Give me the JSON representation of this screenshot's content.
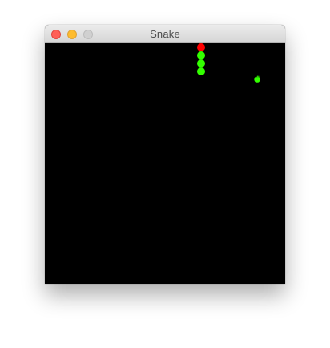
{
  "window": {
    "title": "Snake",
    "buttons": {
      "close": {
        "icon": "close-icon",
        "color": "#ff5f57"
      },
      "minimize": {
        "icon": "minimize-icon",
        "color": "#febc2e"
      },
      "zoom": {
        "icon": "zoom-icon",
        "color": "#d0d0d0"
      }
    }
  },
  "game": {
    "background": "#000000",
    "grid_columns": 30,
    "grid_rows": 30,
    "snake": {
      "head_color": "#ff0000",
      "body_color": "#33ff00",
      "segments": [
        {
          "col": 19,
          "row": 0
        },
        {
          "col": 19,
          "row": 1
        },
        {
          "col": 19,
          "row": 2
        },
        {
          "col": 19,
          "row": 3
        }
      ]
    },
    "apple": {
      "icon": "apple-icon",
      "color": "#33ff00",
      "col": 26,
      "row": 4
    }
  }
}
